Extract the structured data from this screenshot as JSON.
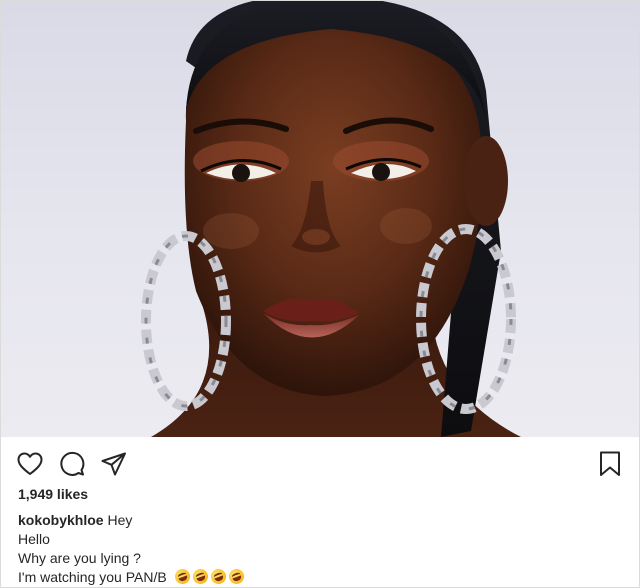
{
  "post": {
    "likes_text": "1,949 likes",
    "caption": {
      "username": "kokobykhloe",
      "first_line_text": "Hey",
      "lines": [
        "Hello",
        "Why are you lying ?",
        "I'm watching you PAN/B"
      ],
      "emoji": "rolling-on-floor-laughing",
      "emoji_count": 4
    }
  },
  "icons": {
    "like": "heart-icon",
    "comment": "comment-bubble-icon",
    "share": "paper-plane-icon",
    "save": "bookmark-icon"
  },
  "colors": {
    "text": "#262626",
    "border": "#dbdbdb",
    "background": "#ffffff"
  }
}
